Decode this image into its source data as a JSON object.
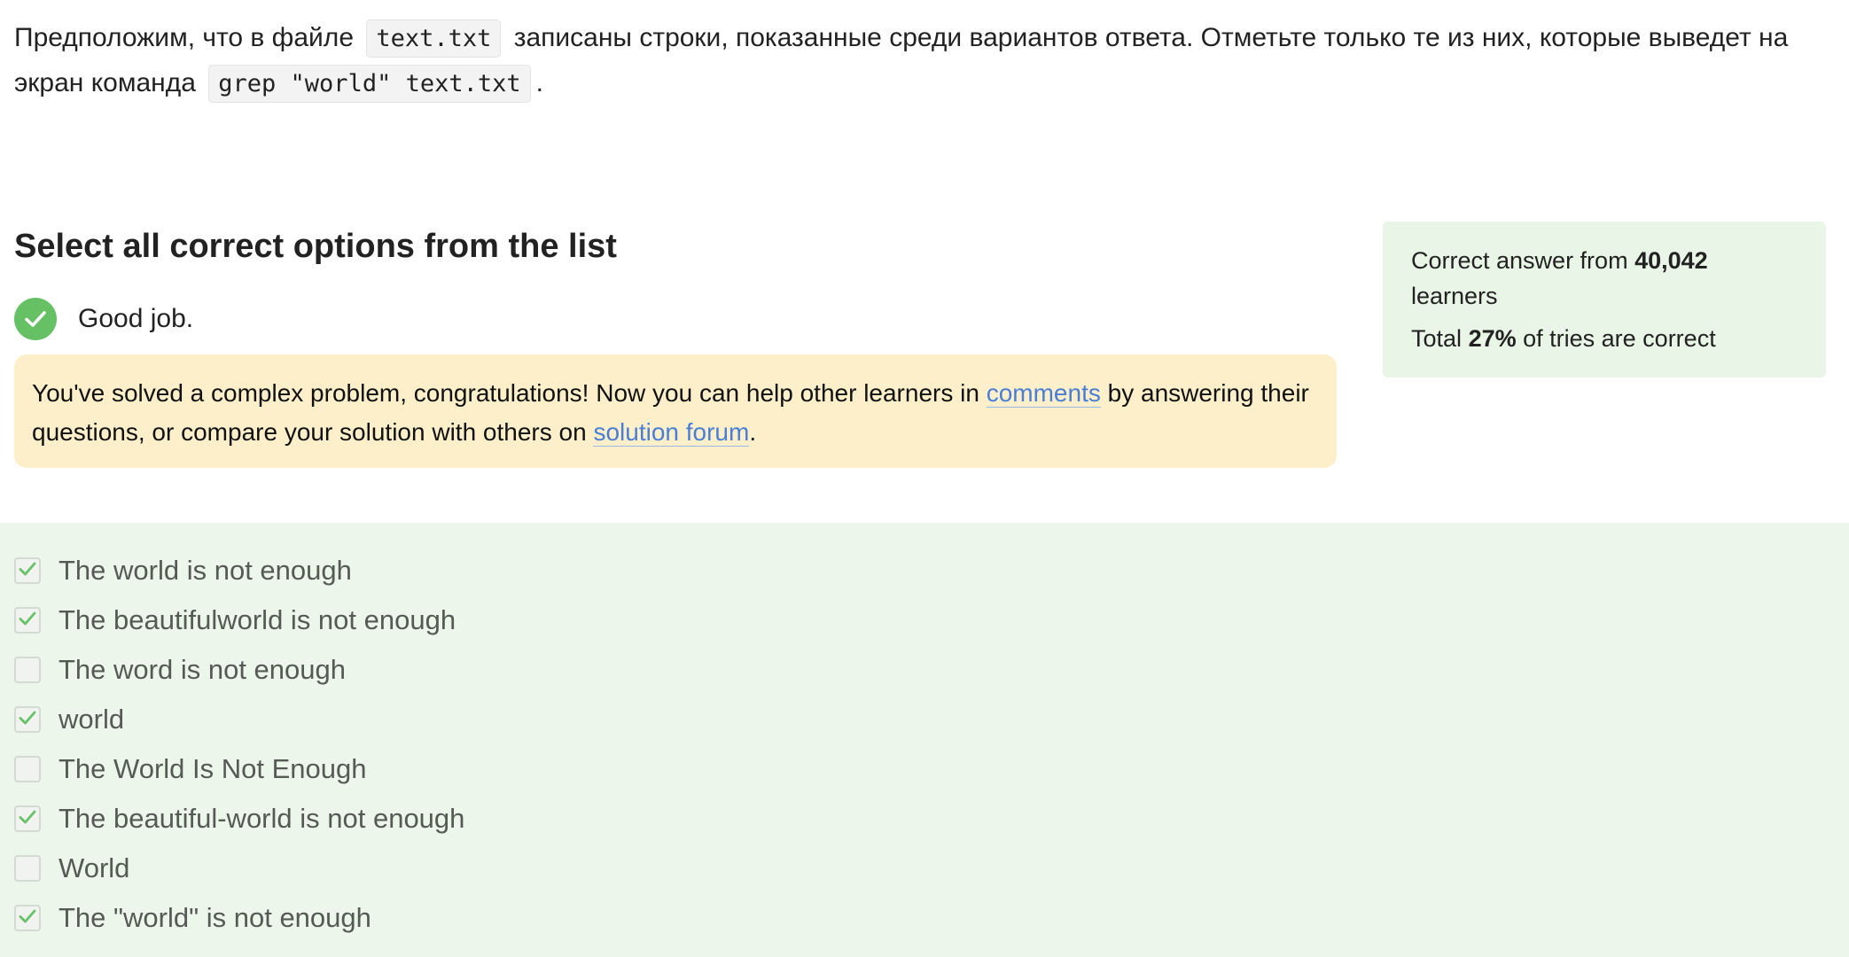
{
  "question": {
    "part1": "Предположим, что в файле",
    "code1": "text.txt",
    "part2": "записаны строки, показанные среди вариантов ответа. Отметьте только те из них, которые выведет на экран команда",
    "code2": "grep \"world\" text.txt",
    "part3": "."
  },
  "heading": "Select all correct options from the list",
  "feedback": {
    "good_job": "Good job."
  },
  "notice": {
    "text1": "You've solved a complex problem, congratulations! Now you can help other learners in",
    "link_comments": "comments",
    "text2": "by answering their questions, or compare your solution with others on",
    "link_forum": "solution forum",
    "text3": "."
  },
  "stats": {
    "line1_prefix": "Correct answer from",
    "learners_count": "40,042",
    "line1_suffix": "learners",
    "line2_prefix": "Total",
    "percent": "27%",
    "line2_suffix": "of tries are correct"
  },
  "options": [
    {
      "label": "The world is not enough",
      "checked": true
    },
    {
      "label": "The beautifulworld is not enough",
      "checked": true
    },
    {
      "label": "The word is not enough",
      "checked": false
    },
    {
      "label": "world",
      "checked": true
    },
    {
      "label": "The World Is Not Enough",
      "checked": false
    },
    {
      "label": "The beautiful-world is not enough",
      "checked": true
    },
    {
      "label": "World",
      "checked": false
    },
    {
      "label": "The \"world\" is not enough",
      "checked": true
    }
  ],
  "colors": {
    "accent_green": "#66c164",
    "link_blue": "#4a7ed6",
    "notice_bg": "#fcefc9",
    "success_bg": "#ecf6ea"
  }
}
